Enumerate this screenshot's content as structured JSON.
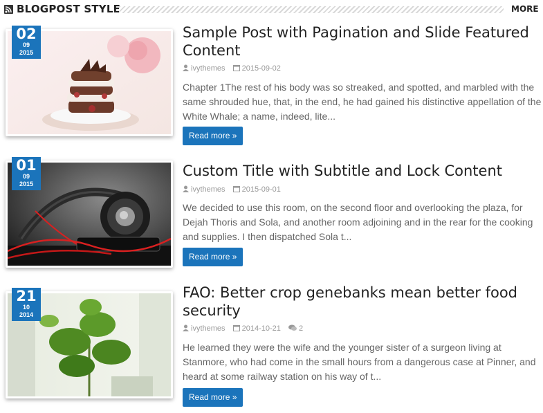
{
  "header": {
    "title": "BLOGPOST STYLE",
    "more_label": "MORE"
  },
  "posts": [
    {
      "date": {
        "day": "02",
        "month": "09",
        "year": "2015"
      },
      "title": "Sample Post with Pagination and Slide Featured Content",
      "author": "ivythemes",
      "published": "2015-09-02",
      "comments": "",
      "excerpt": "Chapter 1The rest of his body was so streaked, and spotted, and marbled with the same shrouded hue, that, in the end, he had gained his distinctive appellation of the White Whale; a name, indeed, lite...",
      "read_more": "Read more »"
    },
    {
      "date": {
        "day": "01",
        "month": "09",
        "year": "2015"
      },
      "title": "Custom Title with Subtitle and Lock Content",
      "author": "ivythemes",
      "published": "2015-09-01",
      "comments": "",
      "excerpt": "We decided to use this room, on the second floor and overlooking the plaza, for Dejah Thoris and Sola, and another room adjoining and in the rear for the cooking and supplies. I then dispatched Sola t...",
      "read_more": "Read more »"
    },
    {
      "date": {
        "day": "21",
        "month": "10",
        "year": "2014"
      },
      "title": "FAO: Better crop genebanks mean better food security",
      "author": "ivythemes",
      "published": "2014-10-21",
      "comments": "2",
      "excerpt": "He learned they were the wife and the younger sister of a surgeon living at Stanmore, who had come in the small hours from a dangerous case at Pinner, and heard at some railway station on his way of t...",
      "read_more": "Read more »"
    }
  ]
}
